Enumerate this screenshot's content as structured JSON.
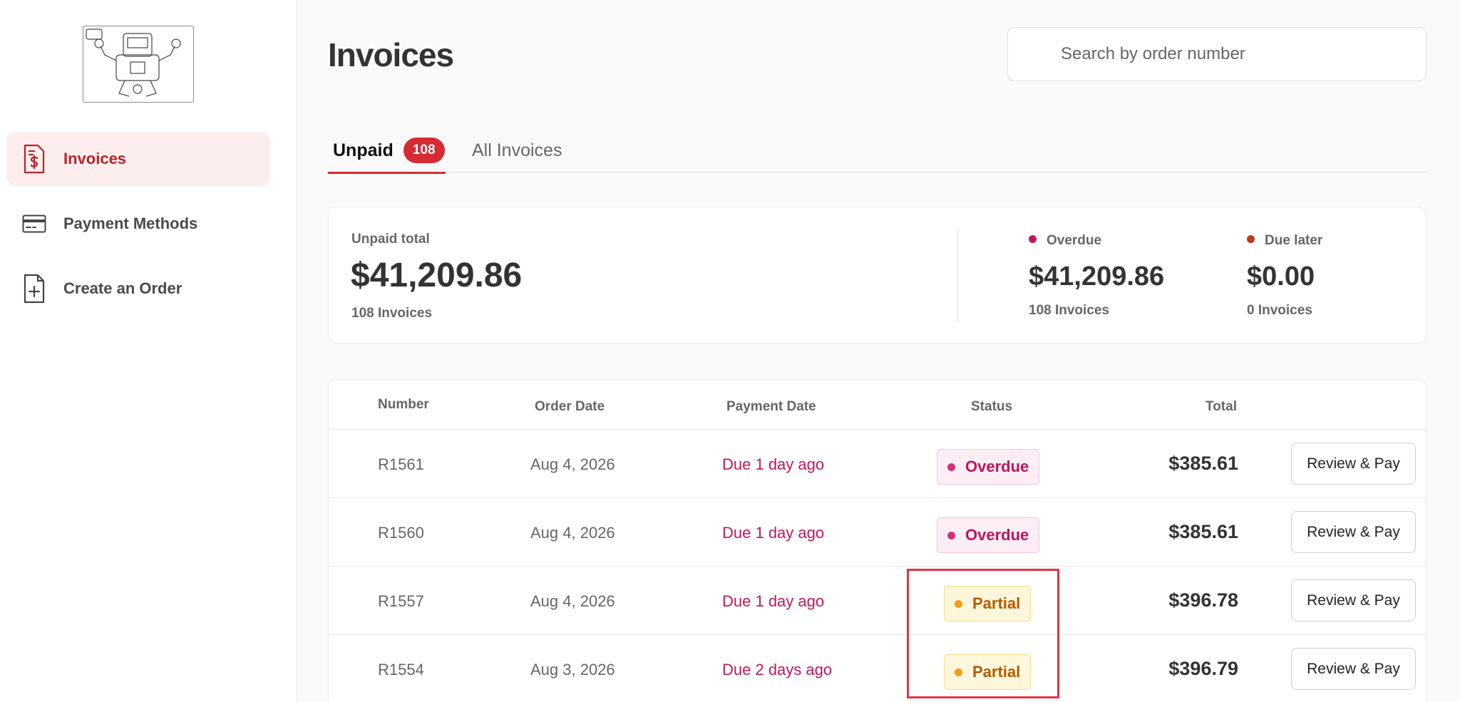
{
  "sidebar": {
    "items": [
      {
        "label": "Invoices"
      },
      {
        "label": "Payment Methods"
      },
      {
        "label": "Create an Order"
      }
    ]
  },
  "header": {
    "title": "Invoices",
    "search_placeholder": "Search by order number"
  },
  "tabs": {
    "unpaid_label": "Unpaid",
    "unpaid_count": "108",
    "all_label": "All Invoices"
  },
  "summary": {
    "unpaid_total_label": "Unpaid total",
    "unpaid_total_amount": "$41,209.86",
    "unpaid_total_count": "108 Invoices",
    "overdue_label": "Overdue",
    "overdue_amount": "$41,209.86",
    "overdue_count": "108 Invoices",
    "overdue_color": "#c2185b",
    "due_later_label": "Due later",
    "due_later_amount": "$0.00",
    "due_later_count": "0 Invoices",
    "due_later_color": "#c0391b"
  },
  "table": {
    "columns": {
      "number": "Number",
      "order_date": "Order Date",
      "payment_date": "Payment Date",
      "status": "Status",
      "total": "Total"
    },
    "rows": [
      {
        "number": "R1561",
        "order_date": "Aug 4, 2026",
        "payment_date": "Due 1 day ago",
        "status": "Overdue",
        "total": "$385.61",
        "action": "Review & Pay"
      },
      {
        "number": "R1560",
        "order_date": "Aug 4, 2026",
        "payment_date": "Due 1 day ago",
        "status": "Overdue",
        "total": "$385.61",
        "action": "Review & Pay"
      },
      {
        "number": "R1557",
        "order_date": "Aug 4, 2026",
        "payment_date": "Due 1 day ago",
        "status": "Partial",
        "total": "$396.78",
        "action": "Review & Pay"
      },
      {
        "number": "R1554",
        "order_date": "Aug 3, 2026",
        "payment_date": "Due 2 days ago",
        "status": "Partial",
        "total": "$396.79",
        "action": "Review & Pay"
      }
    ]
  },
  "colors": {
    "brand": "#d62b33",
    "overdue": "#b8185c",
    "partial": "#b55a00"
  }
}
